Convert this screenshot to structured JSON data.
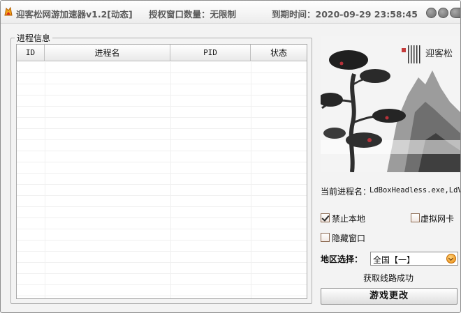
{
  "titlebar": {
    "app_title": "迎客松网游加速器v1.2[动态]",
    "auth_windows": "授权窗口数量：无限制",
    "expire_time": "到期时间：2020-09-29 23:58:45"
  },
  "process_group": {
    "legend": "进程信息",
    "columns": [
      "ID",
      "进程名",
      "PID",
      "状态"
    ],
    "rows": []
  },
  "current_process": {
    "label": "当前进程名：",
    "value": "LdBoxHeadless.exe,LdV"
  },
  "options": {
    "ban_local": {
      "label": "禁止本地",
      "checked": true
    },
    "virtual_nic": {
      "label": "虚拟网卡",
      "checked": false
    },
    "hide_window": {
      "label": "隐藏窗口",
      "checked": false
    }
  },
  "region": {
    "label": "地区选择：",
    "selected": "全国【一】"
  },
  "status": "获取线路成功",
  "action_button": "游戏更改",
  "painting": {
    "inscription": "迎客松"
  },
  "colors": {
    "accent": "#e88a0f",
    "title_text": "#5a5a5a",
    "window_bg": "#f3f3f3"
  }
}
